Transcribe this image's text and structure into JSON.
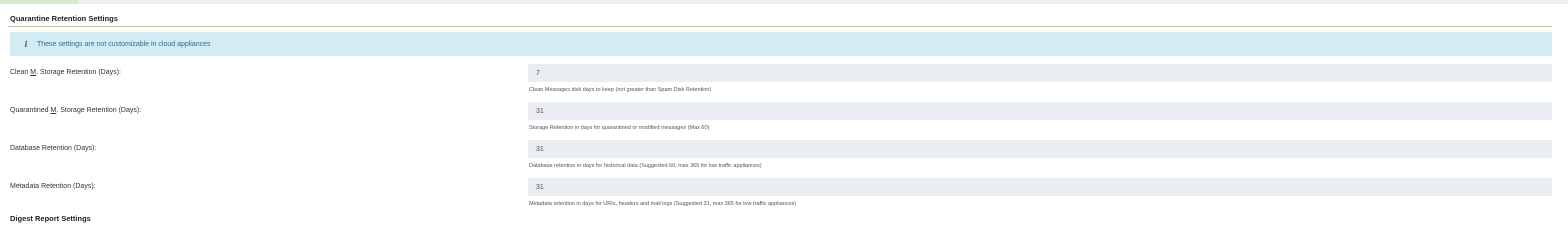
{
  "section": {
    "title": "Quarantine Retention Settings"
  },
  "alert": {
    "icon": "info-icon",
    "glyph": "i",
    "text": "These settings are not customizable in cloud appliances"
  },
  "fields": [
    {
      "label_prefix": "Clean ",
      "label_abbr": "M",
      "label_suffix": ". Storage Retention (Days):",
      "value": "7",
      "help": "Clean Messages disk days to keep (not greater than Spam Disk Retention)"
    },
    {
      "label_prefix": "Quarantined ",
      "label_abbr": "M",
      "label_suffix": ". Storage Retention (Days):",
      "value": "31",
      "help": "Storage Retention in days for quarantined or modified messages (Max 60)"
    },
    {
      "label_prefix": "Database Retention (Days):",
      "label_abbr": "",
      "label_suffix": "",
      "value": "31",
      "help": "Database retention in days for historical data (Suggested 60, max 365 for low traffic appliances)"
    },
    {
      "label_prefix": "Metadata Retention (Days):",
      "label_abbr": "",
      "label_suffix": "",
      "value": "31",
      "help": "Metadata retention in days for URIs, headers and mail logs (Suggested 31, max 365 for low traffic appliances)"
    }
  ],
  "next_section": {
    "title": "Digest Report Settings"
  },
  "colors": {
    "divider": "#a8d58b",
    "alert_bg": "#d3ebf2",
    "alert_text": "#31708f",
    "input_bg": "#eaeef2"
  }
}
